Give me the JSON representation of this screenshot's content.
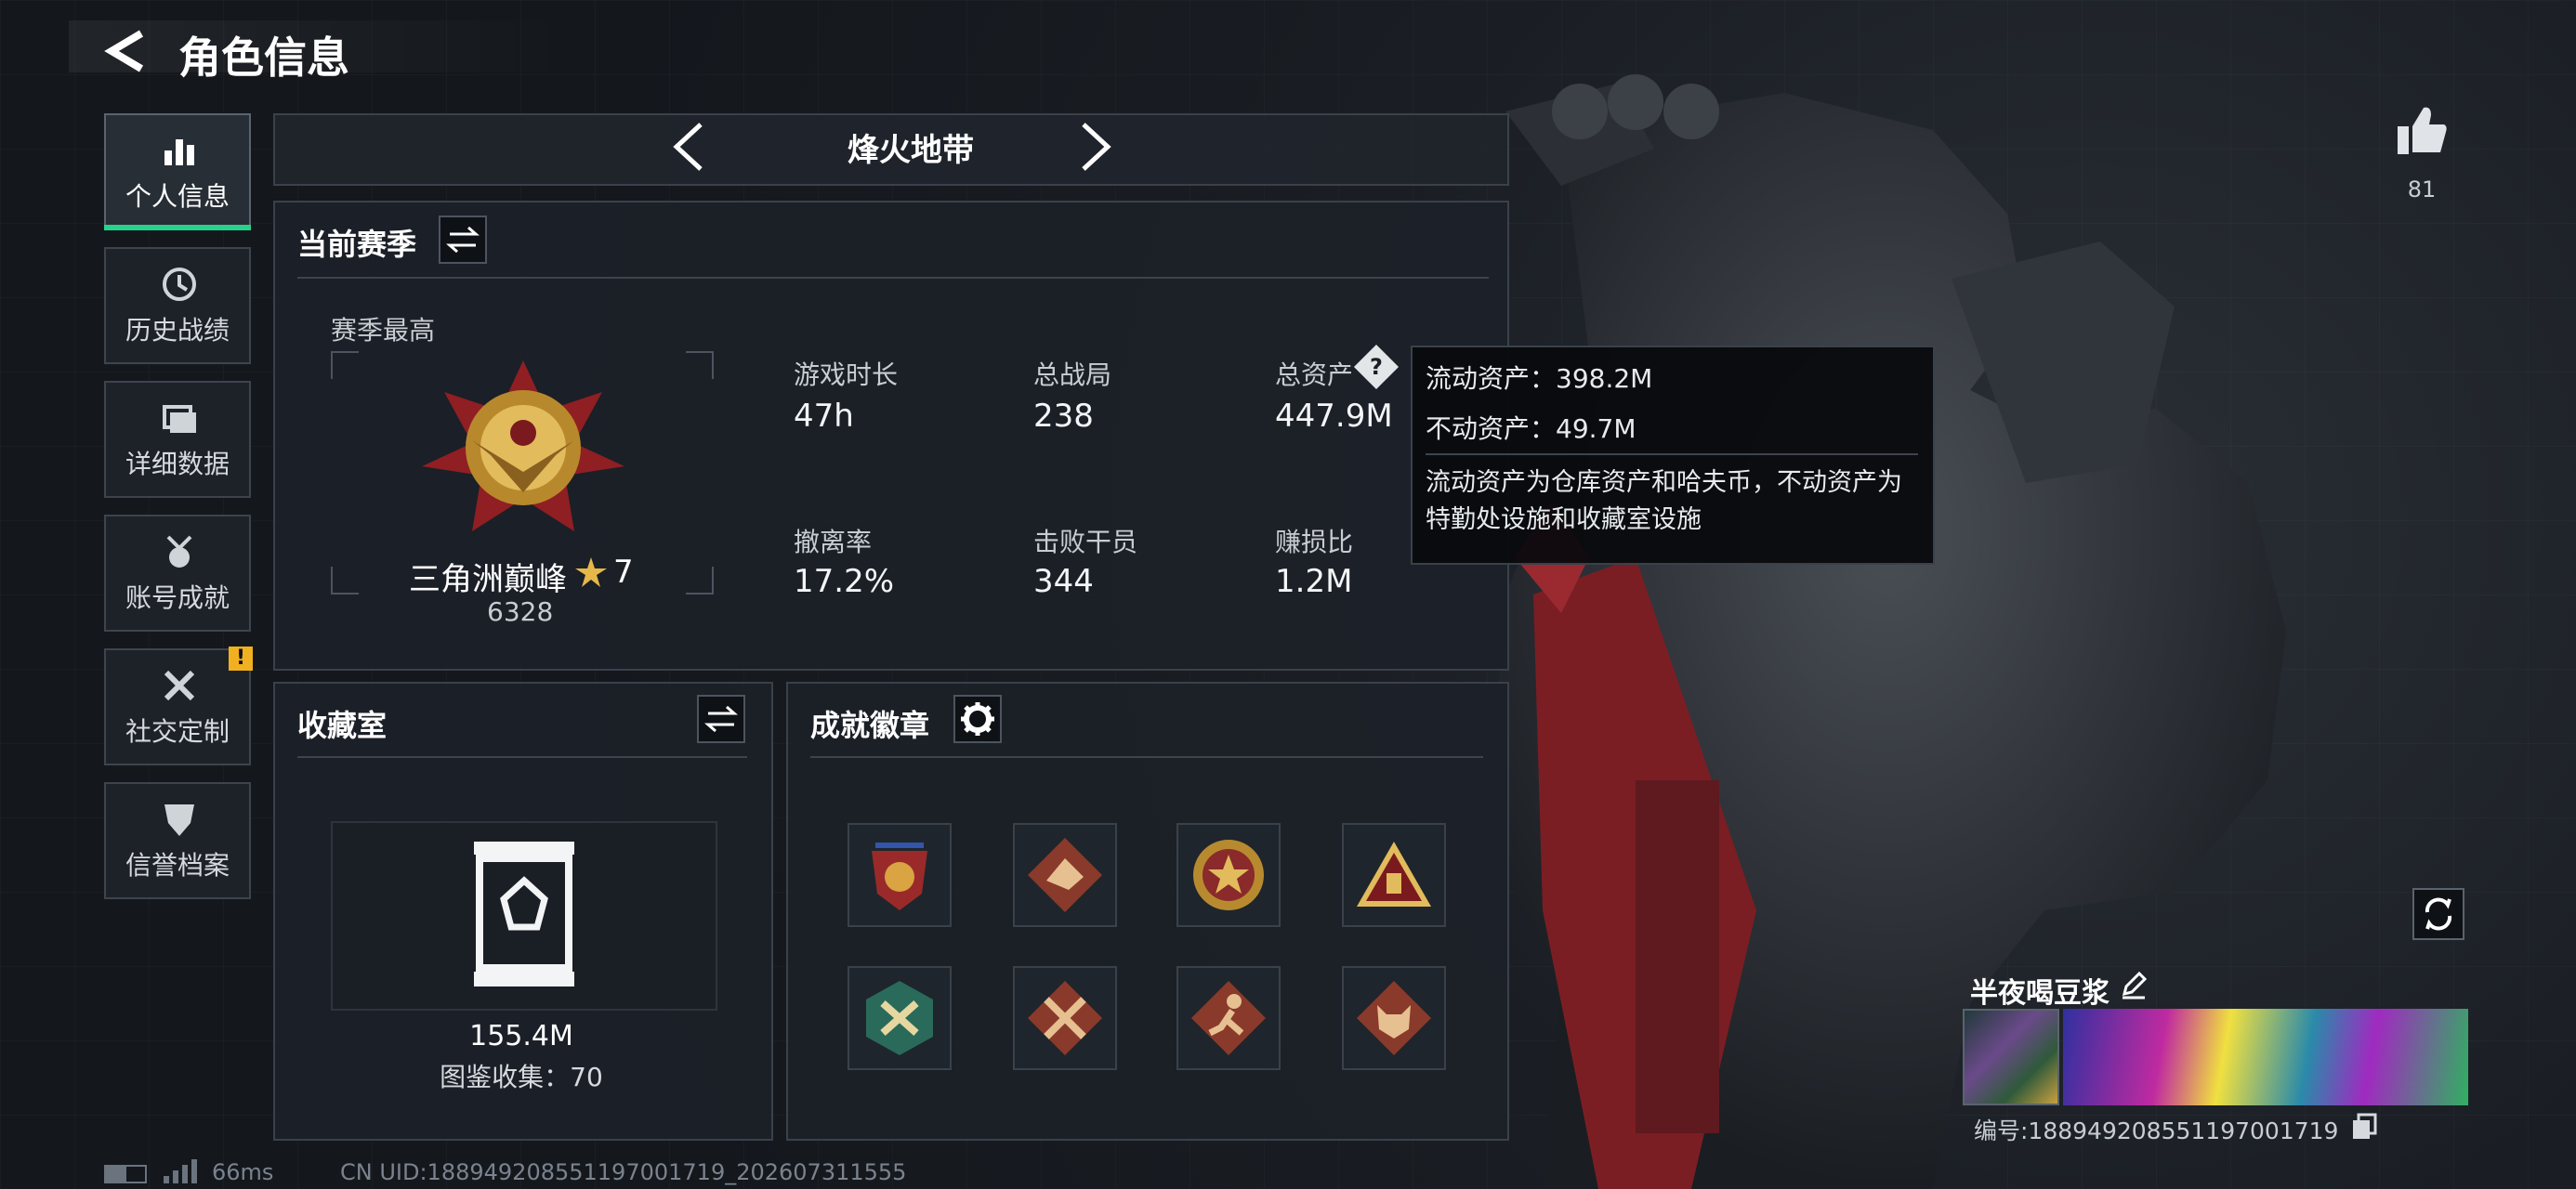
{
  "header": {
    "title": "角色信息"
  },
  "sidebar": {
    "items": [
      {
        "label": "个人信息",
        "active": true
      },
      {
        "label": "历史战绩"
      },
      {
        "label": "详细数据"
      },
      {
        "label": "账号成就"
      },
      {
        "label": "社交定制",
        "alert": "!"
      },
      {
        "label": "信誉档案"
      }
    ]
  },
  "mode_selector": {
    "label": "烽火地带"
  },
  "season": {
    "title": "当前赛季",
    "best_label": "赛季最高",
    "rank_name": "三角洲巅峰",
    "rank_stars": "7",
    "rank_score": "6328",
    "stats": [
      {
        "label": "游戏时长",
        "value": "47h"
      },
      {
        "label": "总战局",
        "value": "238"
      },
      {
        "label": "总资产",
        "value": "447.9M"
      },
      {
        "label": "撤离率",
        "value": "17.2%"
      },
      {
        "label": "击败干员",
        "value": "344"
      },
      {
        "label": "赚损比",
        "value": "1.2M"
      }
    ]
  },
  "tooltip": {
    "liquid": "流动资产：398.2M",
    "fixed": "不动资产：49.7M",
    "note": "流动资产为仓库资产和哈夫币，不动资产为特勤处设施和收藏室设施"
  },
  "collection": {
    "title": "收藏室",
    "value": "155.4M",
    "catalog": "图鉴收集：70"
  },
  "achievements": {
    "title": "成就徽章",
    "badges": [
      "star-shield-badge",
      "dragon-badge",
      "star-medal-badge",
      "triangle-badge",
      "hexagon-tools-badge",
      "crossed-blades-badge",
      "runner-badge",
      "wolf-badge"
    ]
  },
  "likes": {
    "count": "81"
  },
  "player": {
    "name": "半夜喝豆浆",
    "id_text": "编号:18894920855119700171​9"
  },
  "footer": {
    "ping": "66ms",
    "uid": "CN UID:18894920855119700171​9_202607311555"
  },
  "colors": {
    "accent": "#27d38a",
    "alert": "#f0b020",
    "panel": "#1c2128"
  }
}
